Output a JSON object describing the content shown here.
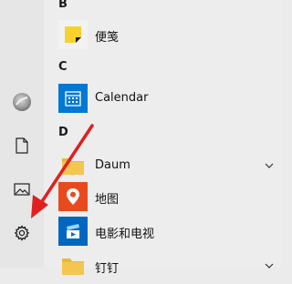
{
  "sections": {
    "b": "B",
    "c": "C",
    "d": "D"
  },
  "apps": {
    "sticky_notes": "便笺",
    "calendar": "Calendar",
    "daum": "Daum",
    "maps": "地图",
    "movies_tv": "电影和电视",
    "dingtalk": "钉钉"
  },
  "rail": {
    "icons": [
      "avatar",
      "document-icon",
      "pictures-icon",
      "settings-icon"
    ]
  },
  "colors": {
    "accent": "#0078d4",
    "arrow": "#e02020",
    "folder": "#f3c74f",
    "sticky": "#f8d22c",
    "maps": "#e84a1e"
  }
}
